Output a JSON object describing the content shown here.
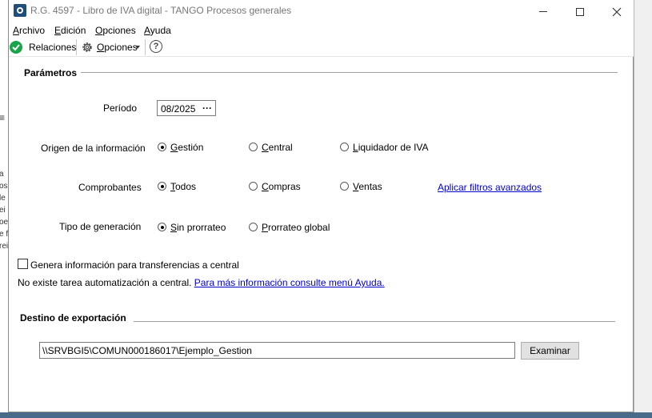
{
  "window": {
    "title": "R.G. 4597 - Libro de IVA digital - TANGO Procesos generales"
  },
  "menu": [
    {
      "u": "A",
      "rest": "rchivo"
    },
    {
      "u": "E",
      "rest": "dición"
    },
    {
      "u": "O",
      "rest": "pciones"
    },
    {
      "u": "A",
      "rest": "yuda"
    }
  ],
  "toolbar": {
    "relaciones_label": "Relaciones",
    "opciones_u": "O",
    "opciones_rest": "pciones",
    "help_glyph": "?"
  },
  "parametros": {
    "title": "Parámetros",
    "periodo": {
      "label": "Período",
      "value": "08/2025",
      "picker_glyph": "···"
    },
    "origen": {
      "label": "Origen de la información",
      "options": [
        {
          "u": "G",
          "rest": "estión",
          "selected": true
        },
        {
          "u": "C",
          "rest": "entral",
          "selected": false
        },
        {
          "u": "L",
          "rest": "iquidador de IVA",
          "selected": false
        }
      ]
    },
    "comprobantes": {
      "label": "Comprobantes",
      "options": [
        {
          "u": "T",
          "rest": "odos",
          "selected": true
        },
        {
          "u": "C",
          "rest": "ompras",
          "selected": false
        },
        {
          "u": "V",
          "rest": "entas",
          "selected": false
        }
      ],
      "link": "Aplicar filtros avanzados"
    },
    "tipo_generacion": {
      "label": "Tipo de generación",
      "options": [
        {
          "u": "S",
          "rest": "in prorrateo",
          "selected": true
        },
        {
          "u": "P",
          "rest": "rorrateo global",
          "selected": false
        }
      ]
    },
    "checkbox": {
      "label": "Genera información para transferencias a central",
      "checked": false
    },
    "info_text": "No existe tarea automatización a central.",
    "info_link": "Para más información consulte menú Ayuda."
  },
  "destino": {
    "title": "Destino de exportación",
    "path": "\\\\SRVBGI5\\COMUN000186017\\Ejemplo_Gestion",
    "examinar_label": "Examinar"
  },
  "background_fragments": [
    "a",
    "os",
    "le",
    "ei",
    "oe",
    "e f",
    "rei"
  ],
  "colors": {
    "link": "#0000cc",
    "check_green": "#1aa34a",
    "taskbar": "#4a6a8a"
  }
}
